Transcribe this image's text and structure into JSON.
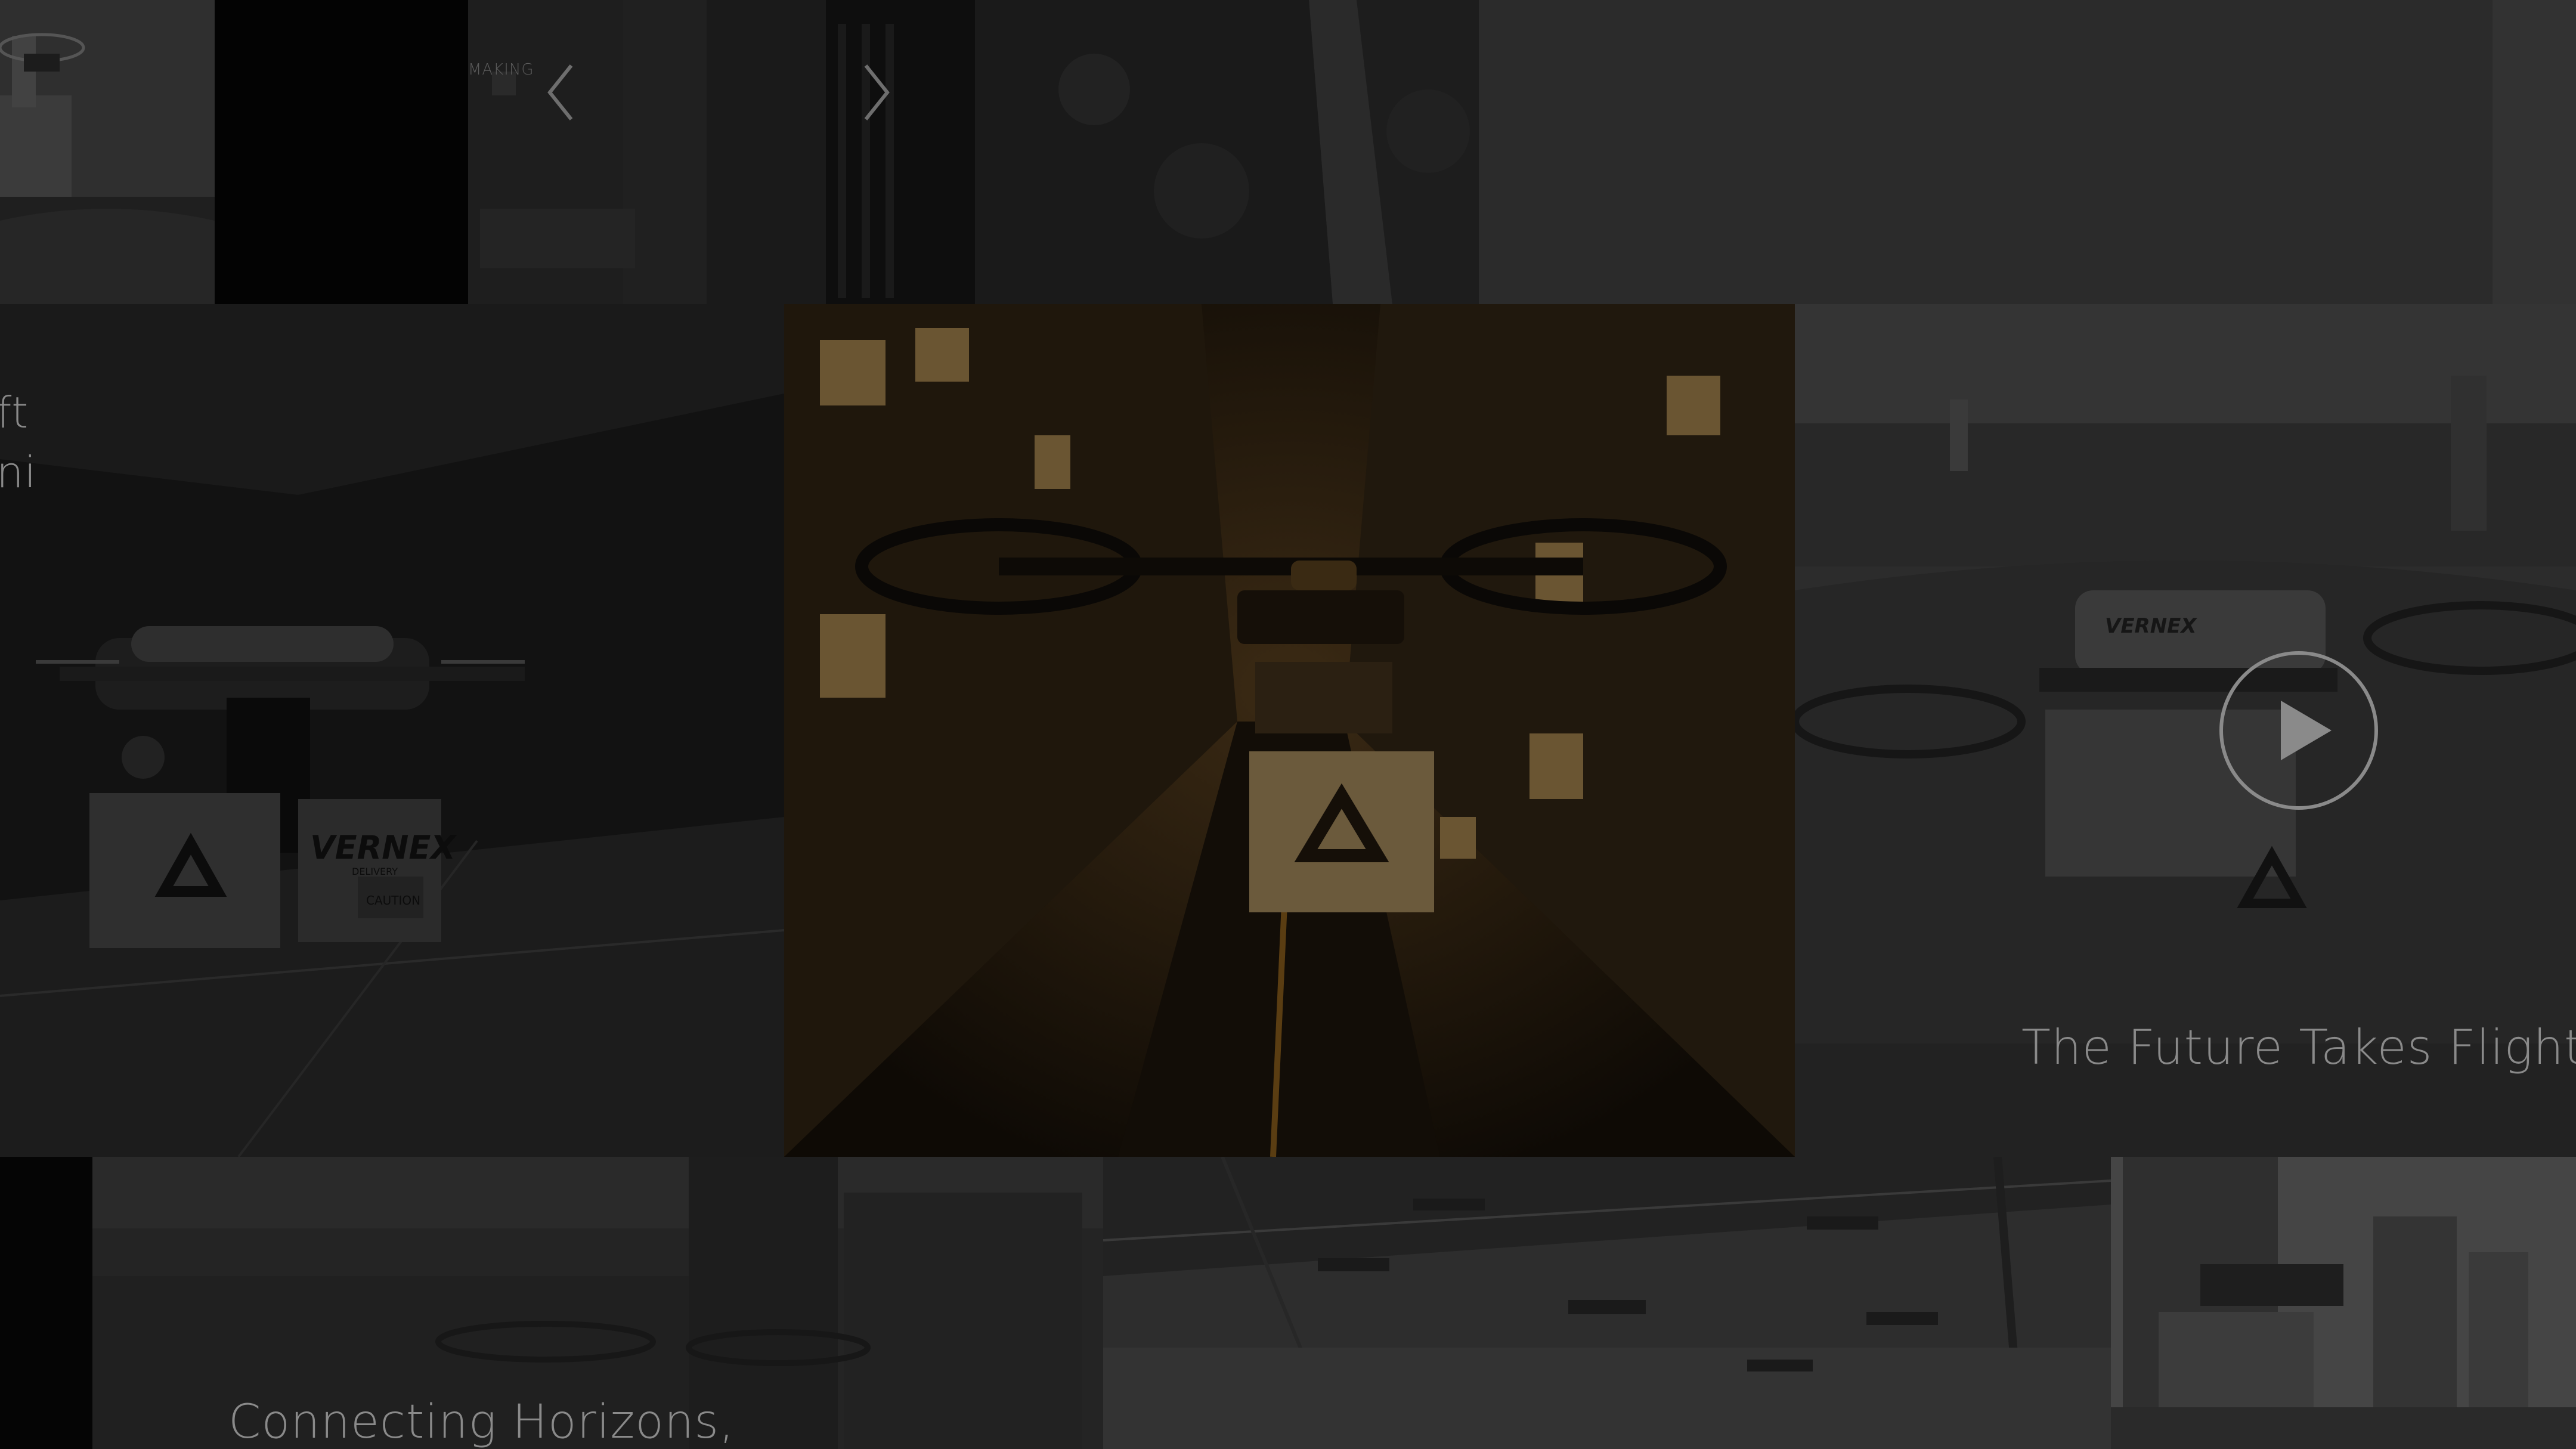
{
  "gallery": {
    "nav": {
      "prev_icon": "chevron-left-icon",
      "next_icon": "chevron-right-icon"
    },
    "top_row": {
      "faint_caption": "MAKING"
    },
    "middle_row": {
      "left_caption_line1": "ft",
      "left_caption_line2": "ni",
      "left_box_brand": "VERNEX",
      "left_box_brand_sub": "DELIVERY",
      "left_box_warning": "CAUTION",
      "right_caption": "The Future Takes Flight",
      "right_box_brand": "VERNEX",
      "play_icon": "play-icon"
    },
    "bottom_row": {
      "caption": "Connecting Horizons,"
    }
  },
  "colors": {
    "background": "#000000",
    "caption_text": "#8a8a8a",
    "center_tint": "#2a1f12",
    "dark_tile": "#303030",
    "light_tile": "#3a3a3a"
  }
}
